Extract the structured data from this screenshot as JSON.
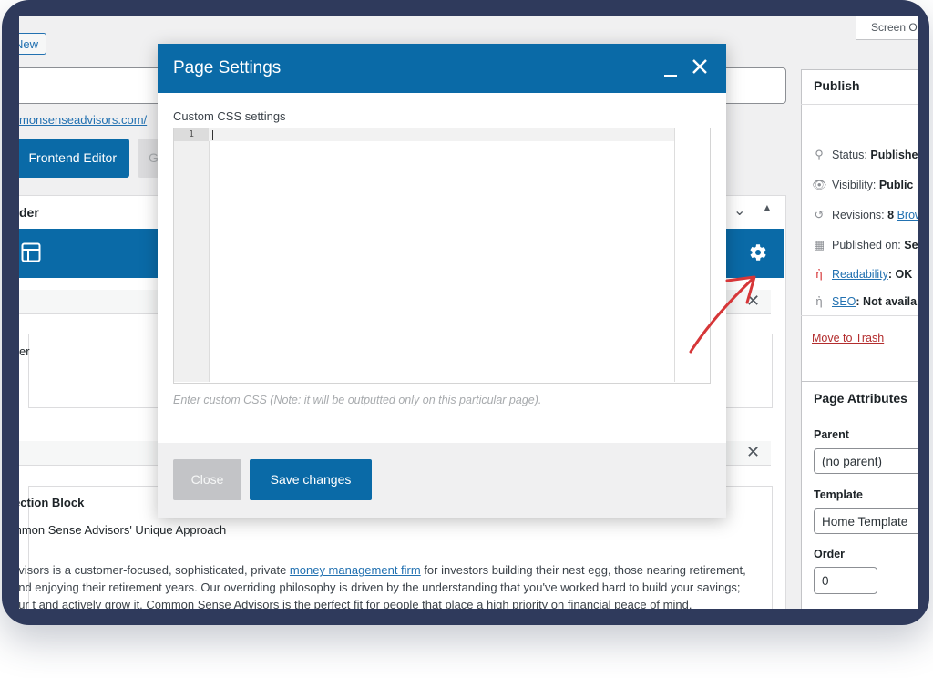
{
  "toolbar": {
    "new_label": "New",
    "screen_options": "Screen O"
  },
  "post": {
    "permalink": "monsenseadvisors.com/"
  },
  "builder": {
    "frontend_button": "Frontend Editor",
    "grey_button": "G",
    "title": "der",
    "block1_text": "er",
    "section_title": "ection Block",
    "section_heading": "mmon Sense Advisors' Unique Approach",
    "para_part1": "dvisors is a customer-focused, sophisticated, private ",
    "para_link": "money management firm",
    "para_part2": " for investors building their nest egg, those nearing retirement, and enjoying their retirement years. Our overriding philosophy is driven by the understanding that you've worked hard to build your savings; our t and actively grow it. Common Sense Advisors is the perfect fit for people that place a high priority on financial peace of mind."
  },
  "publish": {
    "title": "Publish",
    "status_label": "Status: ",
    "status_value": "Published",
    "visibility_label": "Visibility: ",
    "visibility_value": "Public",
    "revisions_label": "Revisions: ",
    "revisions_value": "8",
    "revisions_link": "Brow",
    "published_label": "Published on: ",
    "published_value": "Se",
    "readability_link": "Readability",
    "readability_value": ": OK",
    "seo_link": "SEO",
    "seo_value": ": Not availab",
    "trash_link": "Move to Trash"
  },
  "attributes": {
    "title": "Page Attributes",
    "parent_label": "Parent",
    "parent_value": "(no parent)",
    "template_label": "Template",
    "template_value": "Home Template",
    "order_label": "Order",
    "order_value": "0"
  },
  "modal": {
    "title": "Page Settings",
    "css_label": "Custom CSS settings",
    "line_number": "1",
    "hint": "Enter custom CSS (Note: it will be outputted only on this particular page).",
    "close_button": "Close",
    "save_button": "Save changes"
  },
  "colors": {
    "accent": "#0a6aa7",
    "arrow": "#d63638",
    "frame": "#2f3a5c"
  }
}
